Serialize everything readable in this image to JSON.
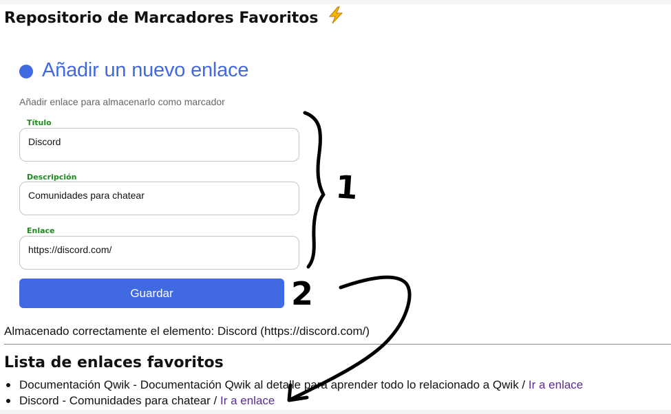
{
  "page": {
    "title": "Repositorio de Marcadores Favoritos",
    "title_icon": "lightning-bolt-icon"
  },
  "form": {
    "title": "Añadir un nuevo enlace",
    "subtitle": "Añadir enlace para almacenarlo como marcador",
    "fields": [
      {
        "label": "Título",
        "value": "Discord"
      },
      {
        "label": "Descripción",
        "value": "Comunidades para chatear"
      },
      {
        "label": "Enlace",
        "value": "https://discord.com/"
      }
    ],
    "save_label": "Guardar"
  },
  "status": {
    "message": "Almacenado correctamente el elemento: Discord (https://discord.com/)"
  },
  "favorites": {
    "title": "Lista de enlaces favoritos",
    "items": [
      {
        "text": "Documentación Qwik - Documentación Qwik al detalle para aprender todo lo relacionado a Qwik / ",
        "link_label": "Ir a enlace"
      },
      {
        "text": "Discord - Comunidades para chatear / ",
        "link_label": "Ir a enlace"
      }
    ]
  },
  "annotations": {
    "label_1": "1",
    "label_2": "2",
    "brace_icon": "curly-brace-icon",
    "arrow_icon": "curved-arrow-icon"
  },
  "colors": {
    "accent": "#4169e1",
    "label_green": "#1e8a1e",
    "link_purple": "#5a2d91"
  }
}
